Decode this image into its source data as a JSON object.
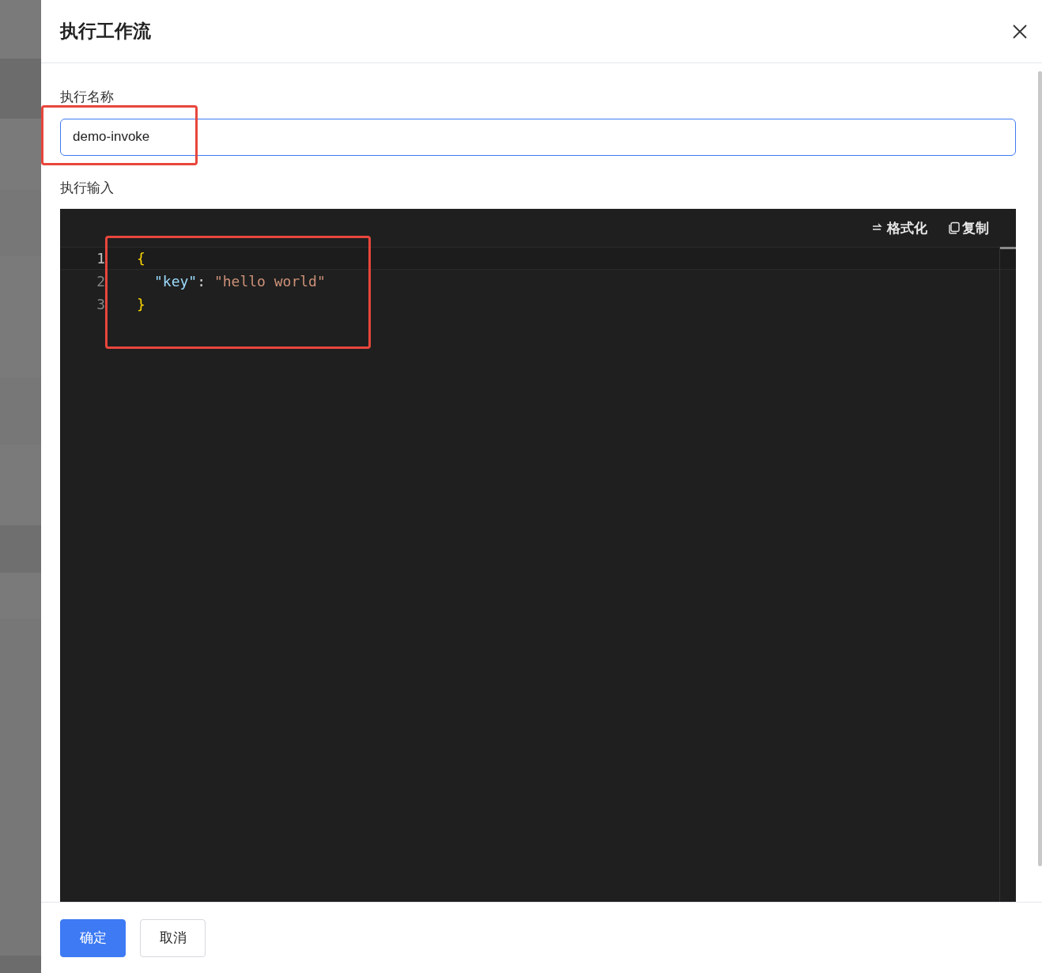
{
  "dialog": {
    "title": "执行工作流"
  },
  "name_field": {
    "label": "执行名称",
    "value": "demo-invoke",
    "focused": true
  },
  "input_editor": {
    "label": "执行输入",
    "toolbar": [
      {
        "kind": "format",
        "label": "格式化"
      },
      {
        "kind": "copy",
        "label": "复制"
      }
    ],
    "lines": [
      {
        "number": "1",
        "active": true,
        "tokens": [
          {
            "kind": "brace",
            "text": "{"
          }
        ]
      },
      {
        "number": "2",
        "active": false,
        "tokens": [
          {
            "kind": "key",
            "text": "\"key\""
          },
          {
            "kind": "punct",
            "text": ": "
          },
          {
            "kind": "string",
            "text": "\"hello world\""
          }
        ]
      },
      {
        "number": "3",
        "active": false,
        "tokens": [
          {
            "kind": "brace",
            "text": "}"
          }
        ]
      }
    ]
  },
  "buttons": [
    {
      "kind": "primary",
      "label": "确定"
    },
    {
      "kind": "secondary",
      "label": "取消"
    }
  ]
}
